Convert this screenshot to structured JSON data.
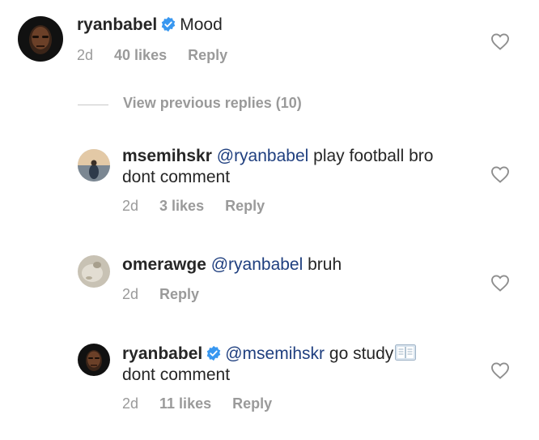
{
  "colors": {
    "verified_badge": "#3897f0",
    "mention": "#1f3f7f",
    "meta_text": "#9a9a9a",
    "heart_outline": "#8e8e8e"
  },
  "comments": [
    {
      "username": "ryanbabel",
      "verified": true,
      "mention": "",
      "text": "Mood",
      "time": "2d",
      "likes": "40 likes",
      "reply": "Reply"
    },
    {
      "username": "msemihskr",
      "verified": false,
      "mention": "@ryanbabel",
      "text": "play football bro",
      "text_line2": "dont comment",
      "time": "2d",
      "likes": "3 likes",
      "reply": "Reply"
    },
    {
      "username": "omerawge",
      "verified": false,
      "mention": "@ryanbabel",
      "text": "bruh",
      "time": "2d",
      "reply": "Reply"
    },
    {
      "username": "ryanbabel",
      "verified": true,
      "mention": "@msemihskr",
      "text": "go study",
      "emoji_icon": "open-book-icon",
      "text_line2": "dont comment",
      "time": "2d",
      "likes": "11 likes",
      "reply": "Reply"
    }
  ],
  "view_previous": "View previous replies (10)"
}
